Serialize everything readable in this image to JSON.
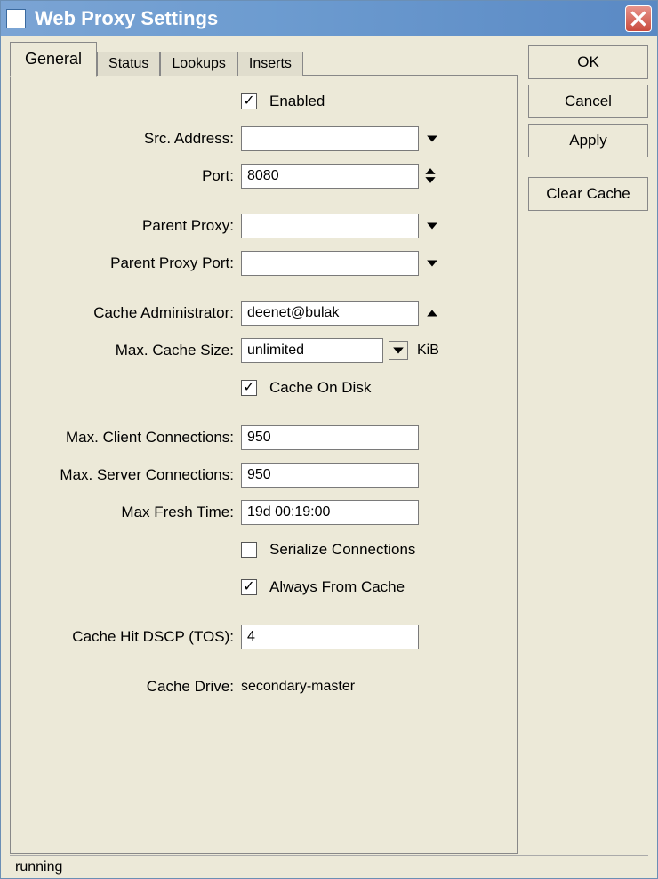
{
  "window": {
    "title": "Web Proxy Settings"
  },
  "tabs": [
    "General",
    "Status",
    "Lookups",
    "Inserts"
  ],
  "buttons": {
    "ok": "OK",
    "cancel": "Cancel",
    "apply": "Apply",
    "clear_cache": "Clear Cache"
  },
  "form": {
    "enabled_label": "Enabled",
    "enabled_checked": true,
    "src_address_label": "Src. Address:",
    "src_address_value": "",
    "port_label": "Port:",
    "port_value": "8080",
    "parent_proxy_label": "Parent Proxy:",
    "parent_proxy_value": "",
    "parent_proxy_port_label": "Parent Proxy Port:",
    "parent_proxy_port_value": "",
    "cache_admin_label": "Cache Administrator:",
    "cache_admin_value": "deenet@bulak",
    "max_cache_size_label": "Max. Cache Size:",
    "max_cache_size_value": "unlimited",
    "max_cache_size_unit": "KiB",
    "cache_on_disk_label": "Cache On Disk",
    "cache_on_disk_checked": true,
    "max_client_conn_label": "Max. Client Connections:",
    "max_client_conn_value": "950",
    "max_server_conn_label": "Max. Server Connections:",
    "max_server_conn_value": "950",
    "max_fresh_time_label": "Max Fresh Time:",
    "max_fresh_time_value": "19d 00:19:00",
    "serialize_conn_label": "Serialize Connections",
    "serialize_conn_checked": false,
    "always_cache_label": "Always From Cache",
    "always_cache_checked": true,
    "cache_hit_dscp_label": "Cache Hit DSCP (TOS):",
    "cache_hit_dscp_value": "4",
    "cache_drive_label": "Cache Drive:",
    "cache_drive_value": "secondary-master"
  },
  "status": "running"
}
